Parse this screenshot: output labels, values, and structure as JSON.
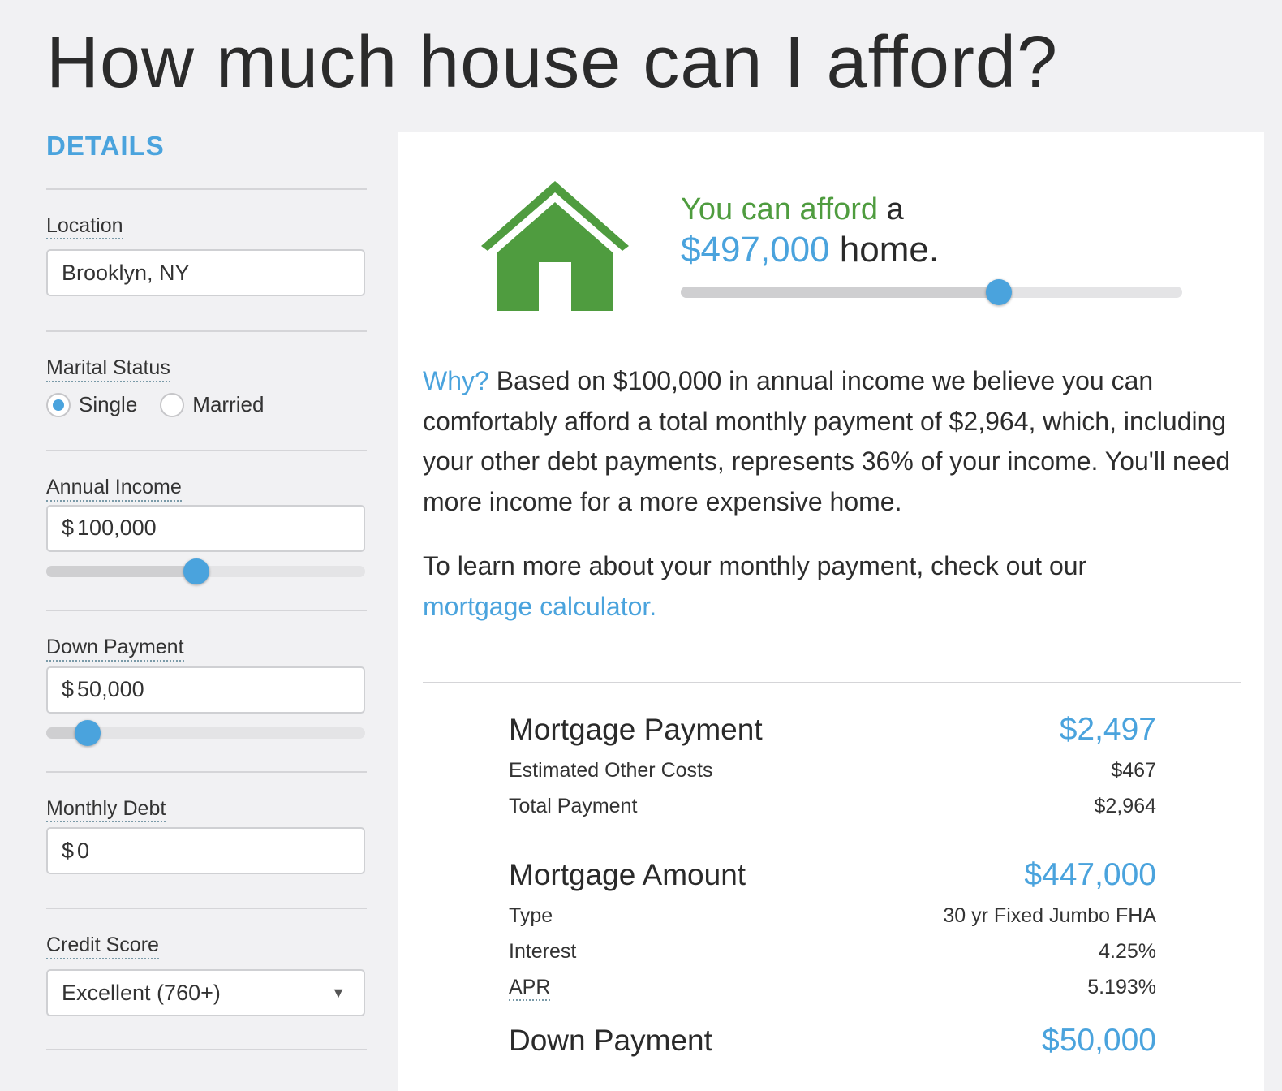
{
  "page": {
    "title": "How much house can I afford?"
  },
  "sidebar": {
    "heading": "DETAILS",
    "location": {
      "label": "Location",
      "value": "Brooklyn, NY"
    },
    "marital_status": {
      "label": "Marital Status",
      "options": [
        "Single",
        "Married"
      ],
      "selected": "Single"
    },
    "annual_income": {
      "label": "Annual Income",
      "currency": "$",
      "value": "100,000",
      "slider_fraction": 0.47
    },
    "down_payment": {
      "label": "Down Payment",
      "currency": "$",
      "value": "50,000",
      "slider_fraction": 0.13
    },
    "monthly_debt": {
      "label": "Monthly Debt",
      "currency": "$",
      "value": "0"
    },
    "credit_score": {
      "label": "Credit Score",
      "value": "Excellent (760+)"
    }
  },
  "result": {
    "lead": "You can afford",
    "article": "a",
    "amount": "$497,000",
    "suffix": "home.",
    "slider_fraction": 0.635
  },
  "explanation": {
    "why": "Why?",
    "text": "Based on $100,000 in annual income we believe you can comfortably afford a total monthly payment of $2,964, which, including your other debt payments, represents 36% of your income. You'll need more income for a more expensive home.",
    "learn_text": "To learn more about your monthly payment, check out our",
    "link": "mortgage calculator."
  },
  "summary": {
    "mortgage_payment": {
      "label": "Mortgage Payment",
      "value": "$2,497"
    },
    "other_costs": {
      "label": "Estimated Other Costs",
      "value": "$467"
    },
    "total_payment": {
      "label": "Total Payment",
      "value": "$2,964"
    },
    "mortgage_amount": {
      "label": "Mortgage Amount",
      "value": "$447,000"
    },
    "type": {
      "label": "Type",
      "value": "30 yr Fixed Jumbo FHA"
    },
    "interest": {
      "label": "Interest",
      "value": "4.25%"
    },
    "apr": {
      "label": "APR",
      "value": "5.193%"
    },
    "down_payment": {
      "label": "Down Payment",
      "value": "$50,000"
    }
  },
  "colors": {
    "accent": "#4aa3dd",
    "brand_green": "#4f9c3f",
    "background": "#f1f1f3"
  },
  "icons": {
    "house": "house-icon",
    "select_arrow": "chevron-down-icon"
  }
}
